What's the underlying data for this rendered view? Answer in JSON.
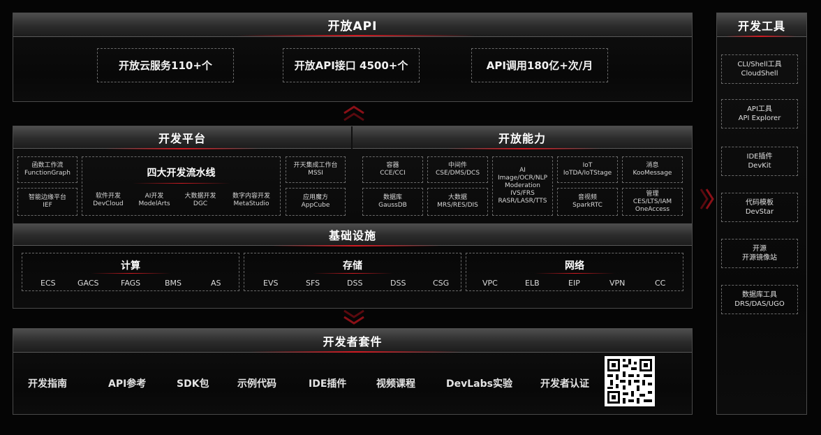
{
  "open_api": {
    "title": "开放API",
    "stats": [
      "开放云服务110+个",
      "开放API接口 4500+个",
      "API调用180亿+次/月"
    ]
  },
  "dev_platform": {
    "title": "开发平台",
    "left_items": [
      {
        "zh": "函数工作流",
        "en": "FunctionGraph"
      },
      {
        "zh": "智能边缘平台",
        "en": "IEF"
      }
    ],
    "pipelines": {
      "title": "四大开发流水线",
      "items": [
        {
          "zh": "软件开发",
          "en": "DevCloud"
        },
        {
          "zh": "AI开发",
          "en": "ModelArts"
        },
        {
          "zh": "大数据开发",
          "en": "DGC"
        },
        {
          "zh": "数字内容开发",
          "en": "MetaStudio"
        }
      ]
    },
    "right_items": [
      {
        "zh": "开天集成工作台",
        "en": "MSSI"
      },
      {
        "zh": "应用魔方",
        "en": "AppCube"
      }
    ]
  },
  "open_capability": {
    "title": "开放能力",
    "cells": [
      {
        "zh": "容器",
        "en": "CCE/CCI"
      },
      {
        "zh": "数据库",
        "en": "GaussDB"
      },
      {
        "zh": "中间件",
        "en": "CSE/DMS/DCS"
      },
      {
        "zh": "大数据",
        "en": "MRS/RES/DIS"
      },
      {
        "lines": [
          "AI",
          "Image/OCR/NLP",
          "Moderation",
          "IVS/FRS",
          "RASR/LASR/TTS"
        ]
      },
      {
        "zh": "IoT",
        "en": "IoTDA/IoTStage"
      },
      {
        "zh": "音视频",
        "en": "SparkRTC"
      },
      {
        "zh": "消息",
        "en": "KooMessage"
      },
      {
        "zh": "管理",
        "en": "CES/LTS/IAM",
        "en2": "OneAccess"
      }
    ]
  },
  "infra": {
    "title": "基础设施",
    "groups": [
      {
        "title": "计算",
        "items": [
          "ECS",
          "GACS",
          "FAGS",
          "BMS",
          "AS"
        ]
      },
      {
        "title": "存储",
        "items": [
          "EVS",
          "SFS",
          "DSS",
          "DSS",
          "CSG"
        ]
      },
      {
        "title": "网络",
        "items": [
          "VPC",
          "ELB",
          "EIP",
          "VPN",
          "CC"
        ]
      }
    ]
  },
  "dev_kit": {
    "title": "开发者套件",
    "items": [
      "开发指南",
      "API参考",
      "SDK包",
      "示例代码",
      "IDE插件",
      "视频课程",
      "DevLabs实验",
      "开发者认证"
    ]
  },
  "dev_tools": {
    "title": "开发工具",
    "items": [
      {
        "zh": "CLI/Shell工具",
        "en": "CloudShell"
      },
      {
        "zh": "API工具",
        "en": "API Explorer"
      },
      {
        "zh": "IDE插件",
        "en": "DevKit"
      },
      {
        "zh": "代码模板",
        "en": "DevStar"
      },
      {
        "zh": "开源",
        "en": "开源镜像站"
      },
      {
        "zh": "数据库工具",
        "en": "DRS/DAS/UGO"
      }
    ]
  },
  "colors": {
    "accent_red": "#d11a22",
    "panel_header": "#3a3a3a",
    "background": "#050505"
  }
}
